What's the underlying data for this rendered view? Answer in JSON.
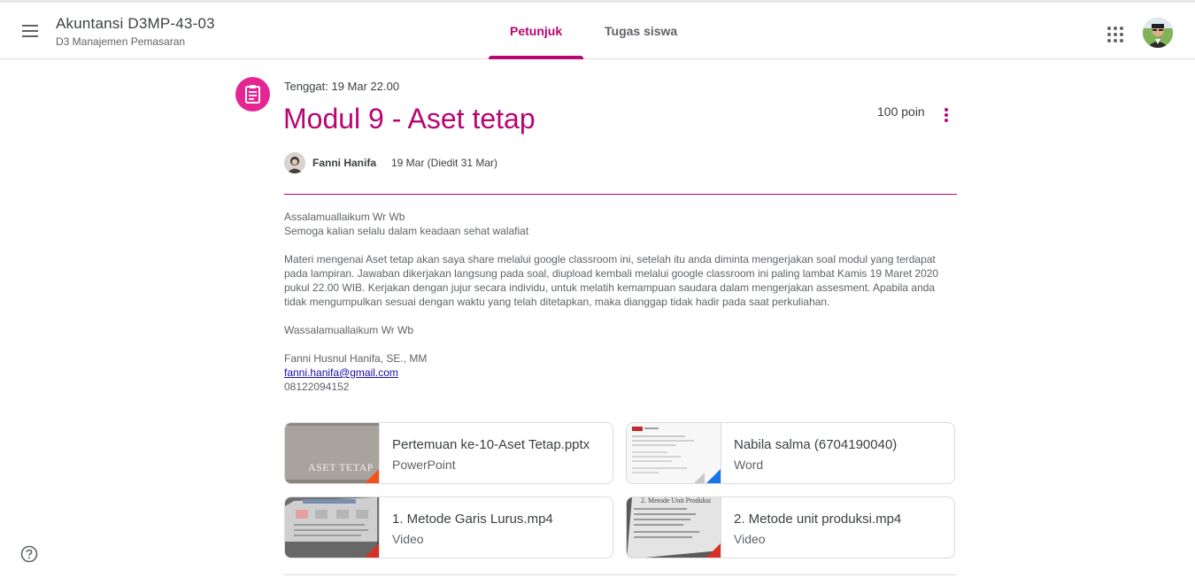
{
  "header": {
    "class_name": "Akuntansi D3MP-43-03",
    "section": "D3 Manajemen Pemasaran",
    "tabs": [
      {
        "label": "Petunjuk",
        "active": true
      },
      {
        "label": "Tugas siswa",
        "active": false
      }
    ],
    "icons": [
      "menu-icon",
      "google-apps-icon",
      "account-avatar"
    ]
  },
  "assignment": {
    "due": "Tenggat: 19 Mar 22.00",
    "title": "Modul 9 - Aset tetap",
    "points": "100 poin",
    "author": "Fanni Hanifa",
    "posted": "19 Mar (Diedit 31 Mar)",
    "accent_color": "#b80672"
  },
  "body": {
    "greeting": "Assalamuallaikum Wr Wb",
    "wish": "Semoga kalian selalu dalam keadaan sehat walafiat",
    "paragraph": "Materi mengenai Aset tetap akan saya share melalui google classroom ini, setelah itu anda diminta mengerjakan soal modul yang terdapat pada lampiran. Jawaban dikerjakan langsung pada soal, diupload kembali melalui google classroom ini paling lambat Kamis 19 Maret 2020 pukul 22.00 WIB. Kerjakan dengan jujur secara individu, untuk melatih kemampuan saudara dalam mengerjakan assesment. Apabila anda tidak mengumpulkan sesuai dengan waktu yang telah ditetapkan, maka dianggap tidak hadir pada saat perkuliahan.",
    "closing": "Wassalamuallaikum Wr Wb",
    "signature_name": "Fanni Husnul Hanifa, SE., MM",
    "email": "fanni.hanifa@gmail.com",
    "phone": "08122094152"
  },
  "attachments": [
    {
      "title": "Pertemuan ke-10-Aset Tetap.pptx",
      "type": "PowerPoint",
      "thumb_text": "ASET TETAP",
      "badge_color": "#f4511e"
    },
    {
      "title": "Nabila salma (6704190040)",
      "type": "Word",
      "badge_color": "#1a73e8"
    },
    {
      "title": "1. Metode Garis Lurus.mp4",
      "type": "Video",
      "badge_color": "#d93025"
    },
    {
      "title": "2. Metode unit produksi.mp4",
      "type": "Video",
      "thumb_text": "2. Metode Unit Produksi",
      "badge_color": "#d93025"
    }
  ]
}
